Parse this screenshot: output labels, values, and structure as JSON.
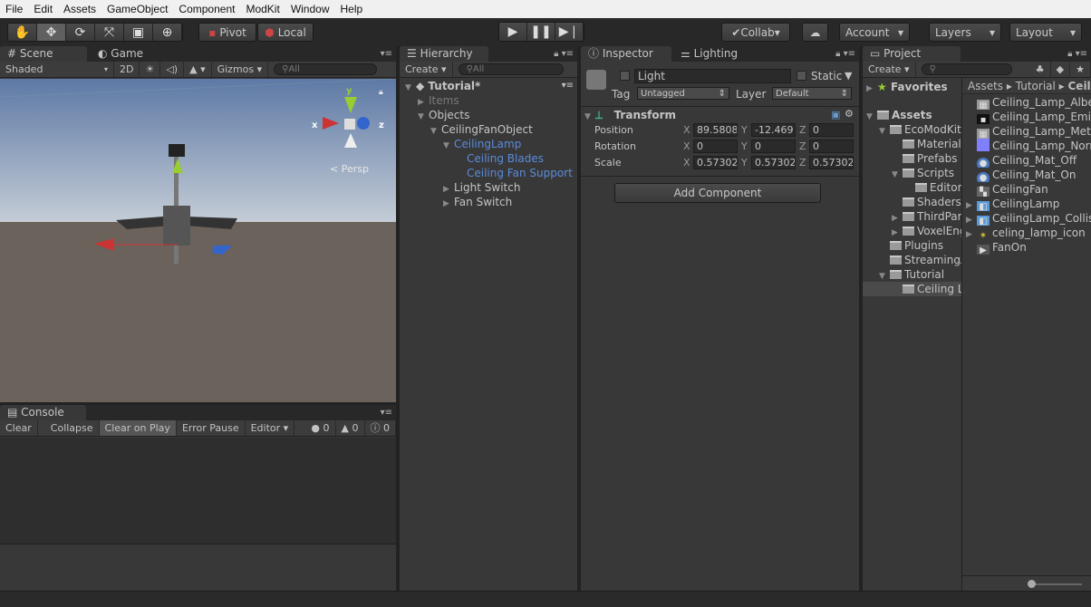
{
  "menu": [
    "File",
    "Edit",
    "Assets",
    "GameObject",
    "Component",
    "ModKit",
    "Window",
    "Help"
  ],
  "toolbar": {
    "tools": [
      "hand-icon",
      "move-icon",
      "rotate-icon",
      "scale-icon",
      "rect-icon",
      "transform-icon"
    ],
    "pivot": "Pivot",
    "local": "Local",
    "collab": "Collab",
    "account": "Account",
    "layers": "Layers",
    "layout": "Layout"
  },
  "scene": {
    "tab": "Scene",
    "game_tab": "Game",
    "shading": "Shaded",
    "mode2d": "2D",
    "gizmos": "Gizmos",
    "search": "All",
    "persp": "< Persp",
    "axis_x": "x",
    "axis_y": "y",
    "axis_z": "z",
    "sky_color": "#6a84ab",
    "ground_color": "#6b625b"
  },
  "console": {
    "tab": "Console",
    "buttons": [
      "Clear",
      "Collapse",
      "Clear on Play",
      "Error Pause",
      "Editor"
    ],
    "errors": "0",
    "warnings": "0",
    "messages": "0"
  },
  "hierarchy": {
    "tab": "Hierarchy",
    "create": "Create",
    "search": "All",
    "scene": "Tutorial*",
    "items": [
      {
        "label": "Items",
        "depth": 1,
        "arrow": "right",
        "color": "dim"
      },
      {
        "label": "Objects",
        "depth": 1,
        "arrow": "down"
      },
      {
        "label": "CeilingFanObject",
        "depth": 2,
        "arrow": "down"
      },
      {
        "label": "CeilingLamp",
        "depth": 3,
        "arrow": "down",
        "color": "blue"
      },
      {
        "label": "Ceiling Blades",
        "depth": 4,
        "color": "blue"
      },
      {
        "label": "Ceiling Fan Support",
        "depth": 4,
        "color": "blue"
      },
      {
        "label": "Light Switch",
        "depth": 3,
        "arrow": "right"
      },
      {
        "label": "Fan Switch",
        "depth": 3,
        "arrow": "right"
      }
    ]
  },
  "inspector": {
    "tab": "Inspector",
    "lighting_tab": "Lighting",
    "name": "Light",
    "static": "Static",
    "tag_label": "Tag",
    "tag": "Untagged",
    "layer_label": "Layer",
    "layer": "Default",
    "component": "Transform",
    "rows": [
      {
        "label": "Position",
        "x": "89.5808",
        "y": "-12.469",
        "z": "0"
      },
      {
        "label": "Rotation",
        "x": "0",
        "y": "0",
        "z": "0"
      },
      {
        "label": "Scale",
        "x": "0.57302",
        "y": "0.57302",
        "z": "0.57302"
      }
    ],
    "add_component": "Add Component"
  },
  "project": {
    "tab": "Project",
    "create": "Create",
    "favorites": "Favorites",
    "breadcrumb": [
      "Assets",
      "Tutorial",
      "Ceiling Lamp"
    ],
    "tree": [
      {
        "label": "Assets",
        "depth": 0,
        "arrow": "down",
        "bold": true
      },
      {
        "label": "EcoModKit",
        "depth": 1,
        "arrow": "down"
      },
      {
        "label": "Materials",
        "depth": 2
      },
      {
        "label": "Prefabs",
        "depth": 2
      },
      {
        "label": "Scripts",
        "depth": 2,
        "arrow": "down"
      },
      {
        "label": "Editor",
        "depth": 3
      },
      {
        "label": "Shaders",
        "depth": 2
      },
      {
        "label": "ThirdParty",
        "depth": 2,
        "arrow": "right"
      },
      {
        "label": "VoxelEngine",
        "depth": 2,
        "arrow": "right"
      },
      {
        "label": "Plugins",
        "depth": 1
      },
      {
        "label": "StreamingAssets",
        "depth": 1
      },
      {
        "label": "Tutorial",
        "depth": 1,
        "arrow": "down"
      },
      {
        "label": "Ceiling Lamp",
        "depth": 2,
        "selected": true
      }
    ],
    "files": [
      {
        "label": "Ceiling_Lamp_Albedo",
        "icon": "texture"
      },
      {
        "label": "Ceiling_Lamp_Emission",
        "icon": "texture-dark"
      },
      {
        "label": "Ceiling_Lamp_Metallic",
        "icon": "texture"
      },
      {
        "label": "Ceiling_Lamp_Normal",
        "icon": "normal"
      },
      {
        "label": "Ceiling_Mat_Off",
        "icon": "material"
      },
      {
        "label": "Ceiling_Mat_On",
        "icon": "material"
      },
      {
        "label": "CeilingFan",
        "icon": "animator"
      },
      {
        "label": "CeilingLamp",
        "icon": "prefab",
        "arrow": true
      },
      {
        "label": "CeilingLamp_Collision",
        "icon": "prefab",
        "arrow": true
      },
      {
        "label": "celing_lamp_icon",
        "icon": "sprite",
        "arrow": true
      },
      {
        "label": "FanOn",
        "icon": "animation"
      }
    ]
  }
}
